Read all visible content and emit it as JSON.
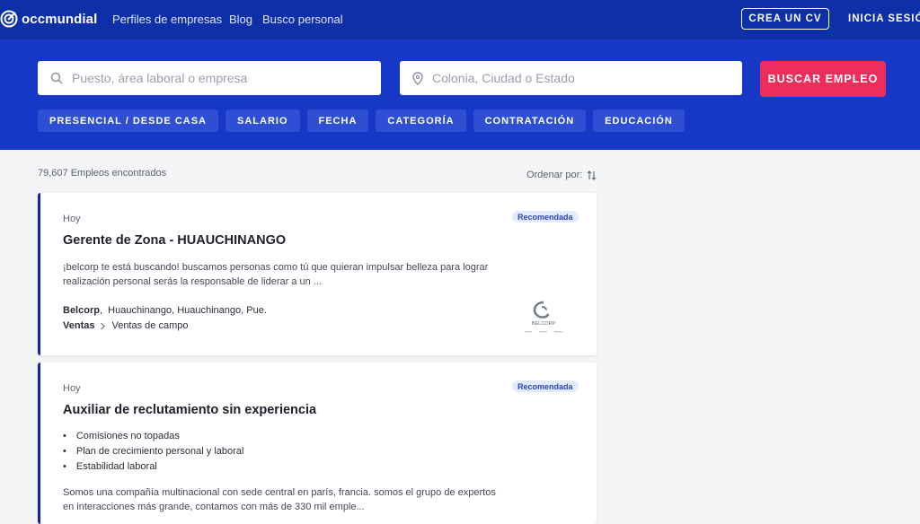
{
  "header": {
    "logo_text": "occmundial",
    "nav": [
      "Perfiles de empresas",
      "Blog",
      "Busco personal"
    ],
    "create_cv": "CREA UN CV",
    "login": "INICIA SESIÓN"
  },
  "search": {
    "keyword_placeholder": "Puesto, área laboral o empresa",
    "location_placeholder": "Colonia, Ciudad o Estado",
    "button": "BUSCAR EMPLEO"
  },
  "filters": [
    "PRESENCIAL / DESDE CASA",
    "SALARIO",
    "FECHA",
    "CATEGORÍA",
    "CONTRATACIÓN",
    "EDUCACIÓN"
  ],
  "results": {
    "count_text": "79,607 Empleos encontrados",
    "sort_label": "Ordenar por:"
  },
  "jobs": [
    {
      "date": "Hoy",
      "badge": "Recomendada",
      "title": "Gerente de Zona - HUAUCHINANGO",
      "description": "¡belcorp te está buscando! buscamos personas como tú que quieran impulsar belleza para lograr realización personal serás la responsable de liderar a un ...",
      "company": "Belcorp",
      "location": "Huauchinango,  Huauchinango,  Pue.",
      "category": "Ventas",
      "subcategory": "Ventas de campo",
      "logo_text": "BELCORP"
    },
    {
      "date": "Hoy",
      "badge": "Recomendada",
      "title": "Auxiliar de reclutamiento sin experiencia",
      "bullets": [
        "Comisiones no topadas",
        "Plan de crecimiento personal y laboral",
        "Estabilidad laboral"
      ],
      "description": "Somos una compañía multinacional con sede central en parís, francia. somos el grupo de expertos en interacciones más grande, contamos con más de 330 mil emple..."
    }
  ],
  "colors": {
    "header_bg": "#0d2fa8",
    "hero_bg": "#1737c6",
    "accent": "#ed2d5c",
    "card_border": "#14259e"
  }
}
